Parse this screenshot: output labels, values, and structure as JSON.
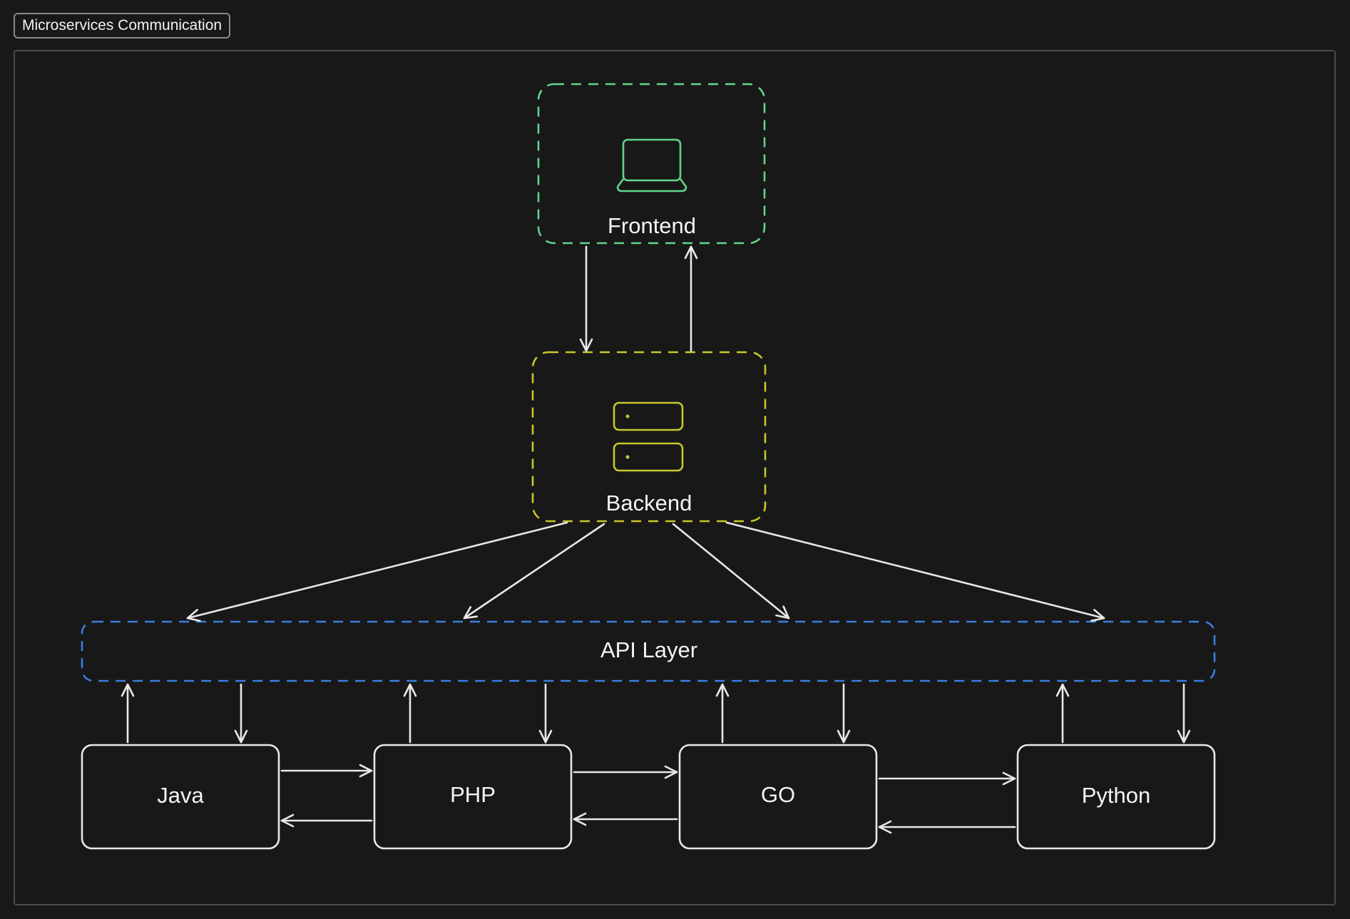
{
  "frame": {
    "title": "Microservices Communication"
  },
  "colors": {
    "background": "#181818",
    "frontend": "#5fd68a",
    "backend": "#c9c62a",
    "api_layer": "#3b7fe0",
    "service_border": "#e8e8e8",
    "arrow": "#e8e8e8"
  },
  "nodes": {
    "frontend": {
      "label": "Frontend",
      "icon": "laptop-icon"
    },
    "backend": {
      "label": "Backend",
      "icon": "server-icon"
    },
    "api_layer": {
      "label": "API Layer"
    },
    "services": [
      {
        "label": "Java"
      },
      {
        "label": "PHP"
      },
      {
        "label": "GO"
      },
      {
        "label": "Python"
      }
    ]
  },
  "edges": [
    {
      "from": "Frontend",
      "to": "Backend"
    },
    {
      "from": "Backend",
      "to": "Frontend"
    },
    {
      "from": "Backend",
      "to": "API Layer"
    },
    {
      "from": "Backend",
      "to": "API Layer"
    },
    {
      "from": "Backend",
      "to": "API Layer"
    },
    {
      "from": "Backend",
      "to": "API Layer"
    },
    {
      "from": "Java",
      "to": "API Layer"
    },
    {
      "from": "API Layer",
      "to": "Java"
    },
    {
      "from": "PHP",
      "to": "API Layer"
    },
    {
      "from": "API Layer",
      "to": "PHP"
    },
    {
      "from": "GO",
      "to": "API Layer"
    },
    {
      "from": "API Layer",
      "to": "GO"
    },
    {
      "from": "Python",
      "to": "API Layer"
    },
    {
      "from": "API Layer",
      "to": "Python"
    },
    {
      "from": "Java",
      "to": "PHP"
    },
    {
      "from": "PHP",
      "to": "Java"
    },
    {
      "from": "PHP",
      "to": "GO"
    },
    {
      "from": "GO",
      "to": "PHP"
    },
    {
      "from": "GO",
      "to": "Python"
    },
    {
      "from": "Python",
      "to": "GO"
    }
  ]
}
